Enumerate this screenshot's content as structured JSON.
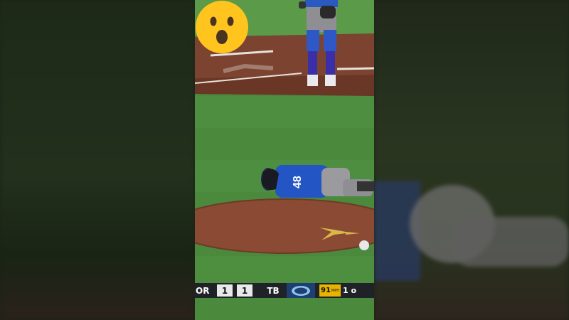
{
  "scoreboard": {
    "away_team": "OR",
    "away_score": "1",
    "home_score": "1",
    "home_team": "TB",
    "pitch_speed": "91",
    "pitch_unit": "MPH",
    "inning": "1 o"
  },
  "player": {
    "jersey_number": "48"
  },
  "colors": {
    "grass": "#4a8a3c",
    "dirt": "#7a3f2a",
    "jersey": "#1f4fb8",
    "emoji": "#ffc41d"
  },
  "icons": {
    "reaction": "astonished-face-emoji"
  }
}
